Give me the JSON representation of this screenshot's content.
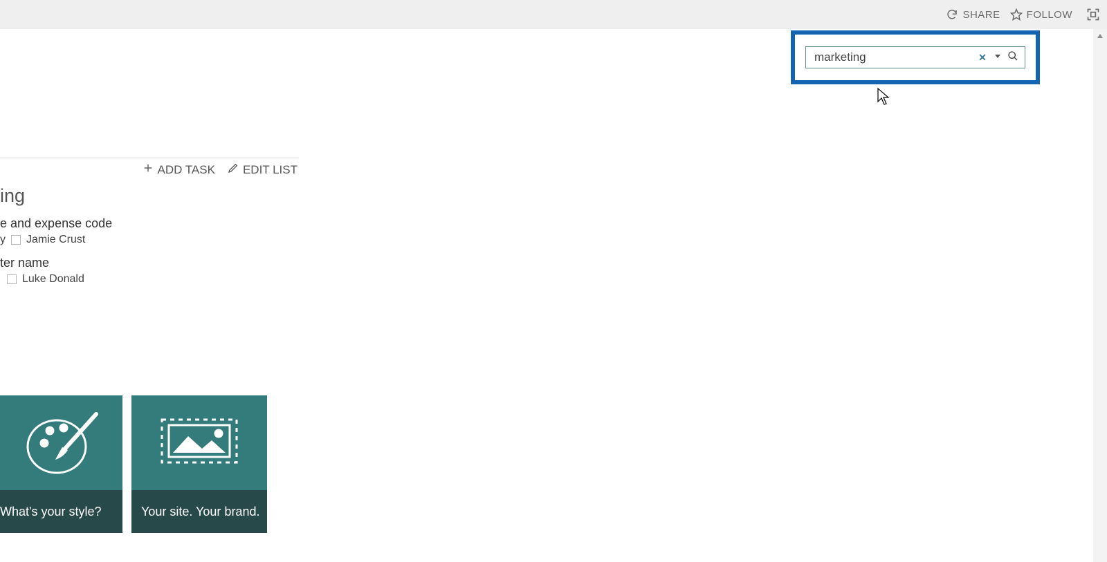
{
  "toolbar": {
    "share_label": "SHARE",
    "follow_label": "FOLLOW"
  },
  "search": {
    "value": "marketing"
  },
  "panel": {
    "add_task_label": "ADD TASK",
    "edit_list_label": "EDIT LIST",
    "heading_fragment": "ing",
    "tasks": [
      {
        "title_fragment": "e and expense code",
        "assignee_fragment_prefix": "y",
        "assignee": "Jamie Crust"
      },
      {
        "title_fragment": "ter name",
        "assignee_fragment_prefix": "",
        "assignee": "Luke Donald"
      }
    ]
  },
  "tiles": [
    {
      "caption": "What's your style?"
    },
    {
      "caption": "Your site. Your brand."
    }
  ]
}
